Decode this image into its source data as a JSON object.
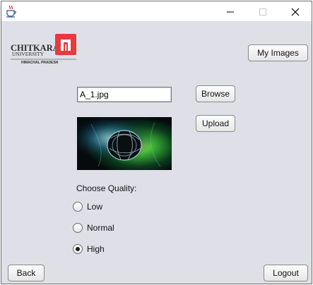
{
  "window": {
    "controls": {
      "minimize_icon": "minimize-icon",
      "maximize_icon": "maximize-icon",
      "close_icon": "close-icon"
    }
  },
  "brand": {
    "name": "CHITKARA",
    "subname": "UNIVERSITY",
    "campus": "HIMACHAL PRADESH",
    "logo_color": "#e53a3f"
  },
  "header": {
    "my_images_label": "My Images"
  },
  "file": {
    "value": "A_1.jpg",
    "browse_label": "Browse",
    "upload_label": "Upload"
  },
  "quality": {
    "heading": "Choose Quality:",
    "options": [
      {
        "label": "Low",
        "selected": false
      },
      {
        "label": "Normal",
        "selected": false
      },
      {
        "label": "High",
        "selected": true
      }
    ]
  },
  "footer": {
    "back_label": "Back",
    "logout_label": "Logout"
  },
  "colors": {
    "window_bg": "#dfe0e7",
    "titlebar_bg": "#ffffff",
    "border": "#707070"
  }
}
